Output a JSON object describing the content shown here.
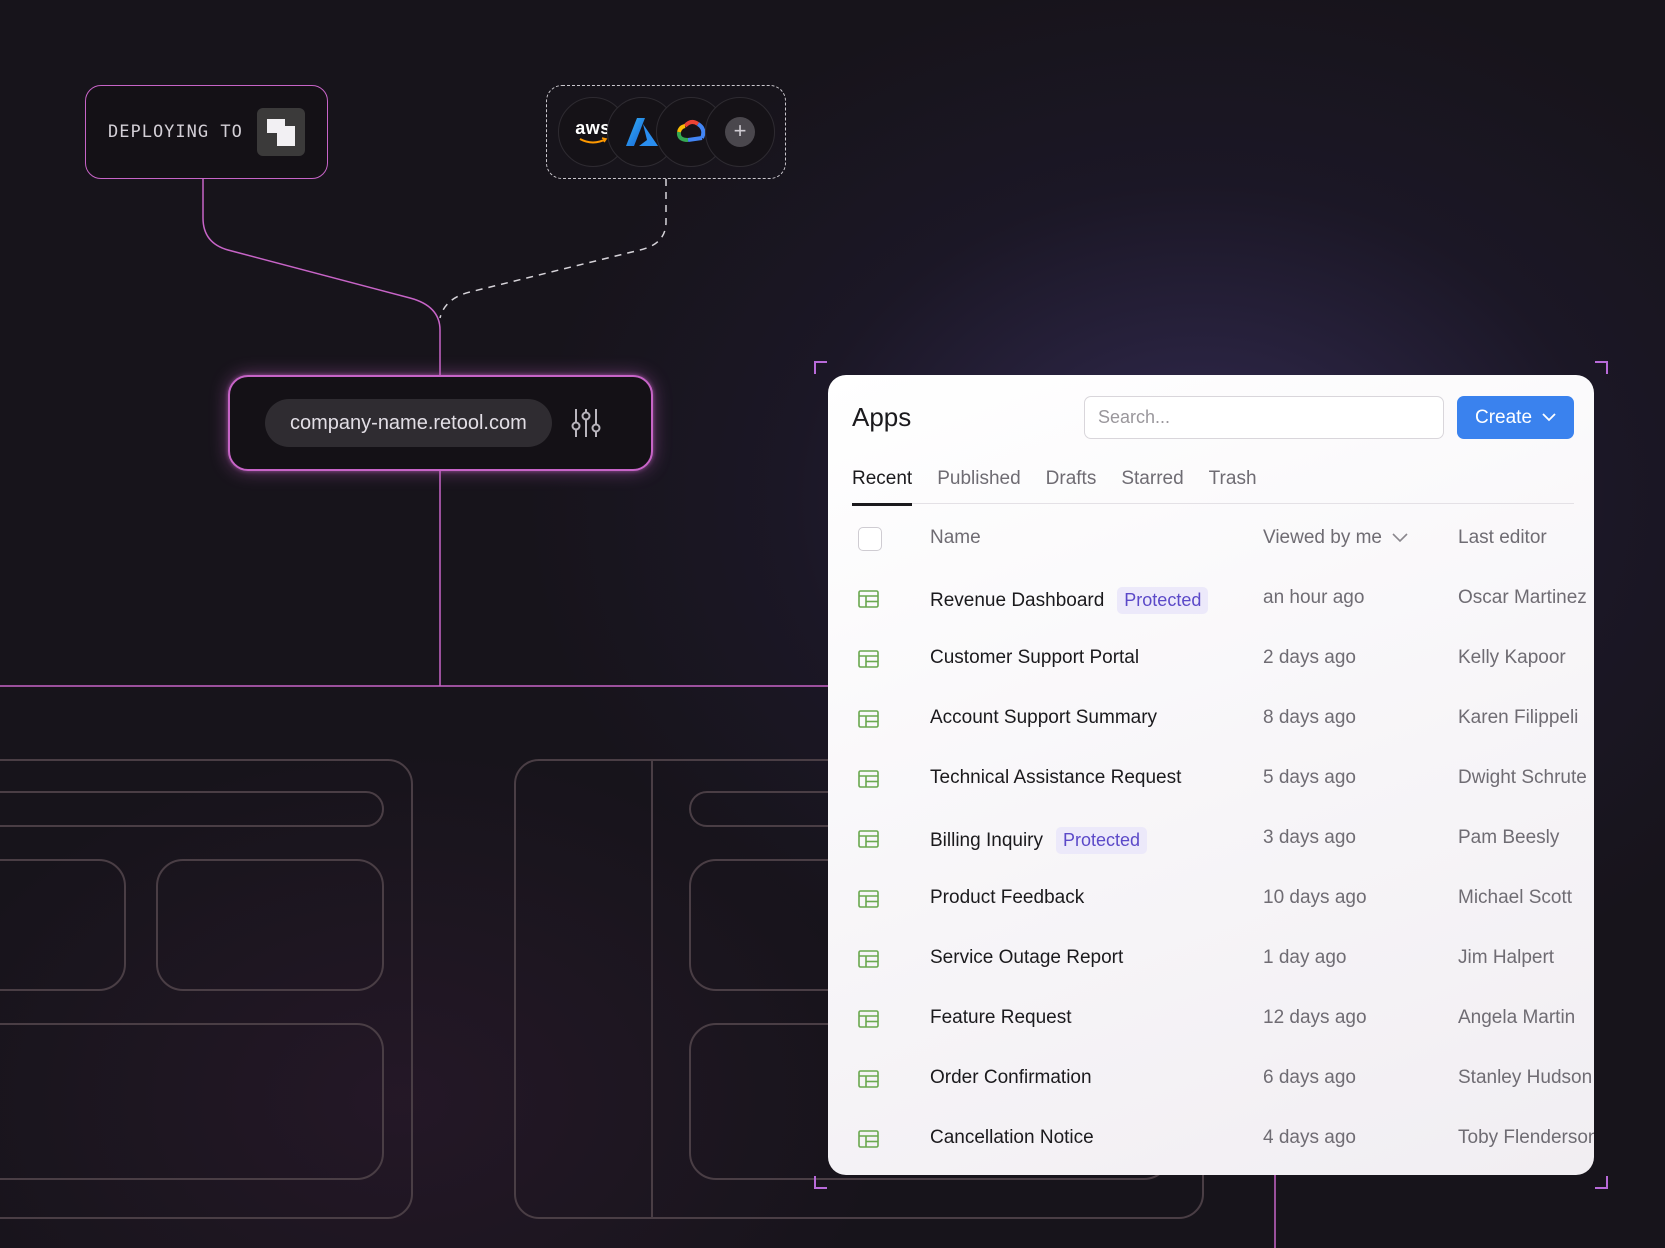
{
  "deploy": {
    "label": "DEPLOYING TO"
  },
  "providers": {
    "items": [
      "aws",
      "azure-icon",
      "google-cloud-icon",
      "plus-icon"
    ],
    "aws_label": "aws",
    "add_label": "+"
  },
  "url_box": {
    "url": "company-name.retool.com"
  },
  "apps": {
    "title": "Apps",
    "search_placeholder": "Search...",
    "create_label": "Create",
    "tabs": [
      "Recent",
      "Published",
      "Drafts",
      "Starred",
      "Trash"
    ],
    "active_tab": "Recent",
    "columns": {
      "name": "Name",
      "viewed": "Viewed by me",
      "editor": "Last editor"
    },
    "rows": [
      {
        "name": "Revenue Dashboard",
        "badge": "Protected",
        "viewed": "an hour ago",
        "editor": "Oscar Martinez"
      },
      {
        "name": "Customer Support Portal",
        "badge": "",
        "viewed": "2 days ago",
        "editor": "Kelly Kapoor"
      },
      {
        "name": "Account Support Summary",
        "badge": "",
        "viewed": "8 days ago",
        "editor": "Karen Filippeli"
      },
      {
        "name": "Technical Assistance Request",
        "badge": "",
        "viewed": "5 days ago",
        "editor": "Dwight Schrute"
      },
      {
        "name": "Billing Inquiry",
        "badge": "Protected",
        "viewed": "3 days ago",
        "editor": "Pam Beesly"
      },
      {
        "name": "Product Feedback",
        "badge": "",
        "viewed": "10 days ago",
        "editor": "Michael Scott"
      },
      {
        "name": "Service Outage Report",
        "badge": "",
        "viewed": "1 day ago",
        "editor": "Jim Halpert"
      },
      {
        "name": "Feature Request",
        "badge": "",
        "viewed": "12 days ago",
        "editor": "Angela Martin"
      },
      {
        "name": "Order Confirmation",
        "badge": "",
        "viewed": "6 days ago",
        "editor": "Stanley Hudson"
      },
      {
        "name": "Cancellation Notice",
        "badge": "",
        "viewed": "4 days ago",
        "editor": "Toby Flenderson"
      }
    ]
  },
  "colors": {
    "accent_pink": "#c764c7",
    "primary_blue": "#3a82ee",
    "badge_text": "#5b49c8",
    "badge_bg": "#ece9fa",
    "app_icon_green": "#6aa84f",
    "background": "#17141b"
  }
}
